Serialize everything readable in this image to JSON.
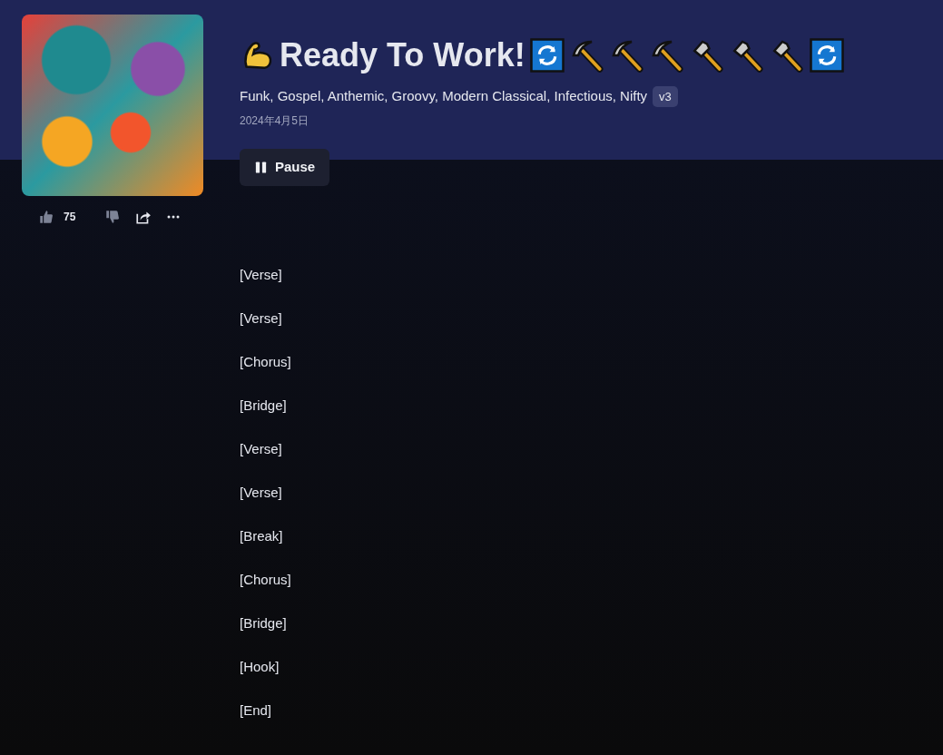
{
  "song": {
    "title": "Ready To Work!",
    "leading_icons": [
      {
        "kind": "muscle"
      }
    ],
    "trailing_icons": [
      {
        "kind": "refresh"
      },
      {
        "kind": "pick"
      },
      {
        "kind": "pick"
      },
      {
        "kind": "pick"
      },
      {
        "kind": "hammer"
      },
      {
        "kind": "hammer"
      },
      {
        "kind": "hammer"
      },
      {
        "kind": "refresh"
      }
    ],
    "tags": "Funk, Gospel, Anthemic, Groovy, Modern Classical, Infectious, Nifty",
    "version": "v3",
    "date": "2024年4月5日"
  },
  "actions": {
    "likes": "75"
  },
  "play_button": {
    "label": "Pause"
  },
  "lyrics": [
    "[Verse]",
    "[Verse]",
    "[Chorus]",
    "[Bridge]",
    "[Verse]",
    "[Verse]",
    "[Break]",
    "[Chorus]",
    "[Bridge]",
    "[Hook]",
    "[End]"
  ]
}
